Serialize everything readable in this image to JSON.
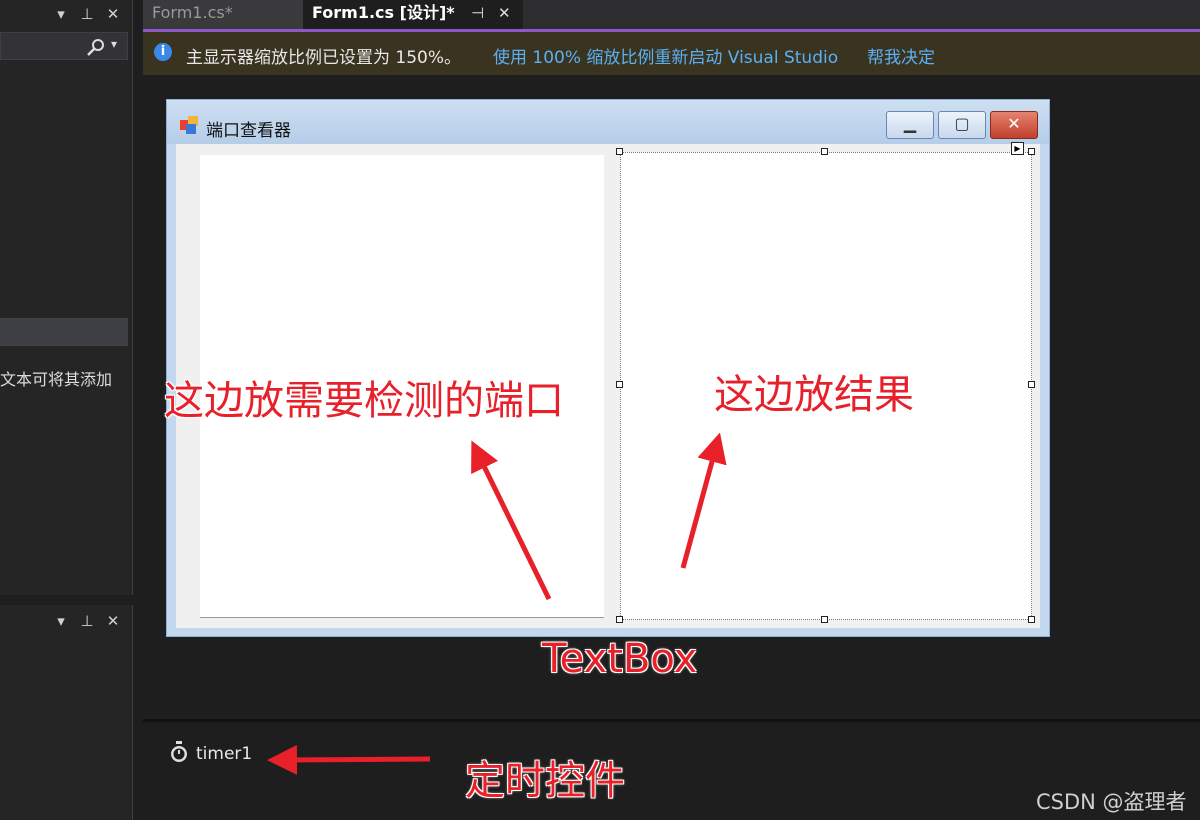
{
  "left_panel": {
    "search_icon": "search-icon",
    "clipped_text": "文本可将其添加"
  },
  "tabs": [
    {
      "label": "Form1.cs*"
    },
    {
      "label": "Form1.cs [设计]*"
    }
  ],
  "infobar": {
    "message": "主显示器缩放比例已设置为 150%。",
    "link_restart": "使用 100% 缩放比例重新启动 Visual Studio",
    "link_decide": "帮我决定"
  },
  "form": {
    "title": "端口查看器"
  },
  "tray": {
    "timer_label": "timer1"
  },
  "annotations": {
    "left_note": "这边放需要检测的端口",
    "right_note": "这边放结果",
    "textbox_note": "TextBox",
    "timer_note": "定时控件"
  },
  "watermark": "CSDN @盗理者",
  "colors": {
    "accent": "#8c5ac8",
    "link": "#5ab0f2",
    "annotation": "#e8202a"
  }
}
